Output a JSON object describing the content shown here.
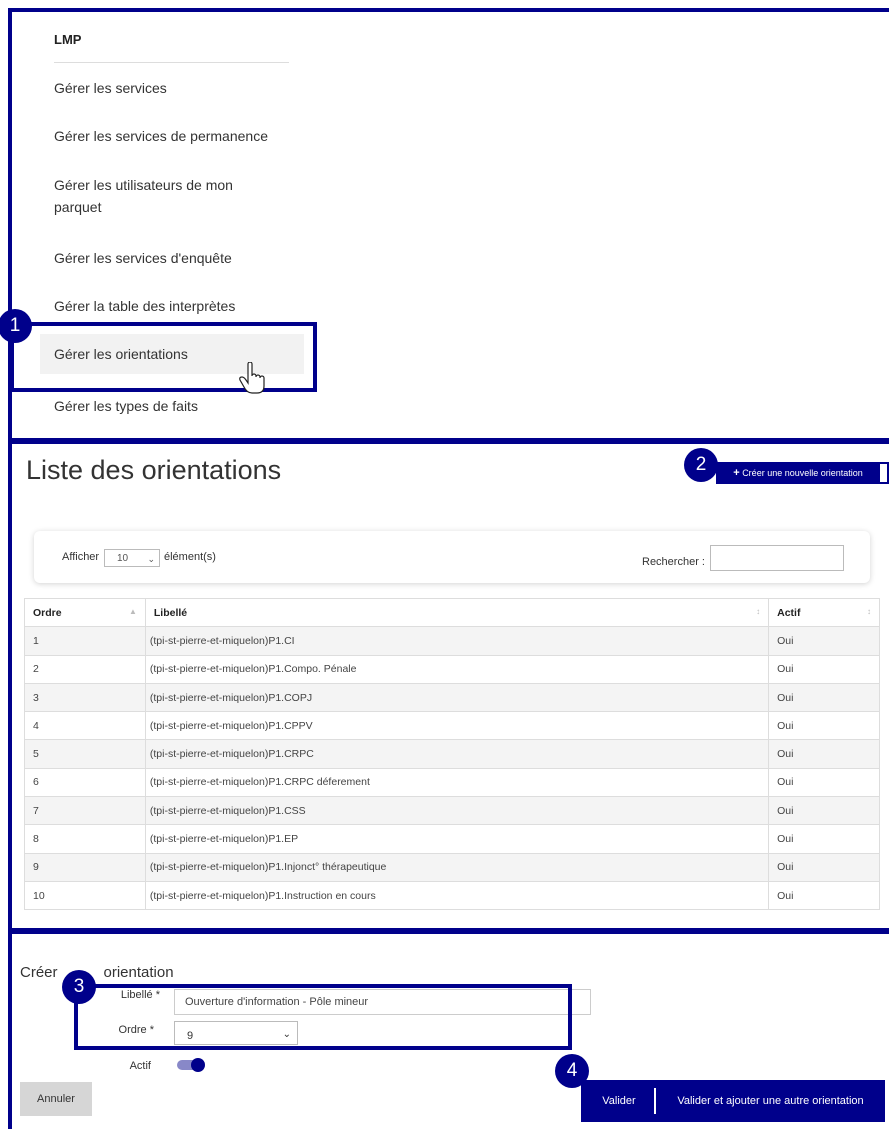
{
  "sidebar": {
    "title": "LMP",
    "items": [
      {
        "label": "Gérer les services"
      },
      {
        "label": "Gérer les services de permanence"
      },
      {
        "label": "Gérer les utilisateurs de mon",
        "label2": "parquet"
      },
      {
        "label": "Gérer les services d'enquête"
      },
      {
        "label": "Gérer la table des interprètes"
      },
      {
        "label": "Gérer les orientations"
      },
      {
        "label": "Gérer les types de faits"
      }
    ]
  },
  "badges": [
    "1",
    "2",
    "3",
    "4"
  ],
  "list": {
    "title": "Liste des orientations",
    "create_button": "Créer une nouvelle orientation",
    "afficher": "Afficher",
    "page_length": "10",
    "elements": "élément(s)",
    "rechercher": "Rechercher :",
    "headers": [
      "Ordre",
      "Libellé",
      "Actif"
    ],
    "rows": [
      [
        "1",
        "(tpi-st-pierre-et-miquelon)P1.CI",
        "Oui"
      ],
      [
        "2",
        "(tpi-st-pierre-et-miquelon)P1.Compo. Pénale",
        "Oui"
      ],
      [
        "3",
        "(tpi-st-pierre-et-miquelon)P1.COPJ",
        "Oui"
      ],
      [
        "4",
        "(tpi-st-pierre-et-miquelon)P1.CPPV",
        "Oui"
      ],
      [
        "5",
        "(tpi-st-pierre-et-miquelon)P1.CRPC",
        "Oui"
      ],
      [
        "6",
        "(tpi-st-pierre-et-miquelon)P1.CRPC déferement",
        "Oui"
      ],
      [
        "7",
        "(tpi-st-pierre-et-miquelon)P1.CSS",
        "Oui"
      ],
      [
        "8",
        "(tpi-st-pierre-et-miquelon)P1.EP",
        "Oui"
      ],
      [
        "9",
        "(tpi-st-pierre-et-miquelon)P1.Injonct° thérapeutique",
        "Oui"
      ],
      [
        "10",
        "(tpi-st-pierre-et-miquelon)P1.Instruction en cours",
        "Oui"
      ]
    ]
  },
  "form": {
    "title_left": "Créer",
    "title_right": "orientation",
    "libelle_label": "Libellé *",
    "libelle_value": "Ouverture d'information - Pôle mineur",
    "ordre_label": "Ordre *",
    "ordre_value": "9",
    "actif_label": "Actif",
    "actif_on": true,
    "cancel": "Annuler",
    "valider": "Valider",
    "valider_autre": "Valider et ajouter une autre orientation"
  },
  "colors": {
    "accent": "#00008b"
  }
}
